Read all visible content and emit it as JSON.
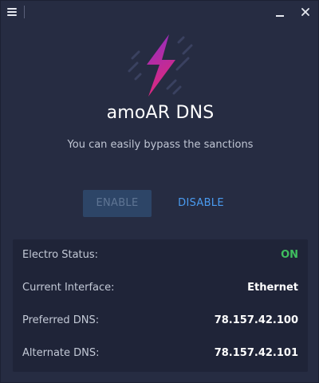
{
  "app": {
    "title": "amoAR DNS",
    "subtitle": "You can easily bypass the sanctions"
  },
  "titlebar": {
    "menu_icon": "hamburger-menu-icon",
    "minimize_icon": "minimize-icon",
    "close_icon": "close-icon"
  },
  "logo": {
    "icon": "lightning-bolt-icon",
    "gradient_top": "#8b2fc9",
    "gradient_bottom": "#e0287a"
  },
  "actions": {
    "enable_label": "ENABLE",
    "enable_state": "disabled",
    "disable_label": "DISABLE"
  },
  "info": {
    "rows": [
      {
        "label": "Electro Status:",
        "value": "ON"
      },
      {
        "label": "Current Interface:",
        "value": "Ethernet"
      },
      {
        "label": "Preferred DNS:",
        "value": "78.157.42.100"
      },
      {
        "label": "Alternate DNS:",
        "value": "78.157.42.101"
      }
    ]
  },
  "colors": {
    "background": "#262c42",
    "panel": "#1f2438",
    "accent": "#4a9bf0",
    "status_on": "#3fbf5f",
    "enable_bg": "#2d4567"
  }
}
